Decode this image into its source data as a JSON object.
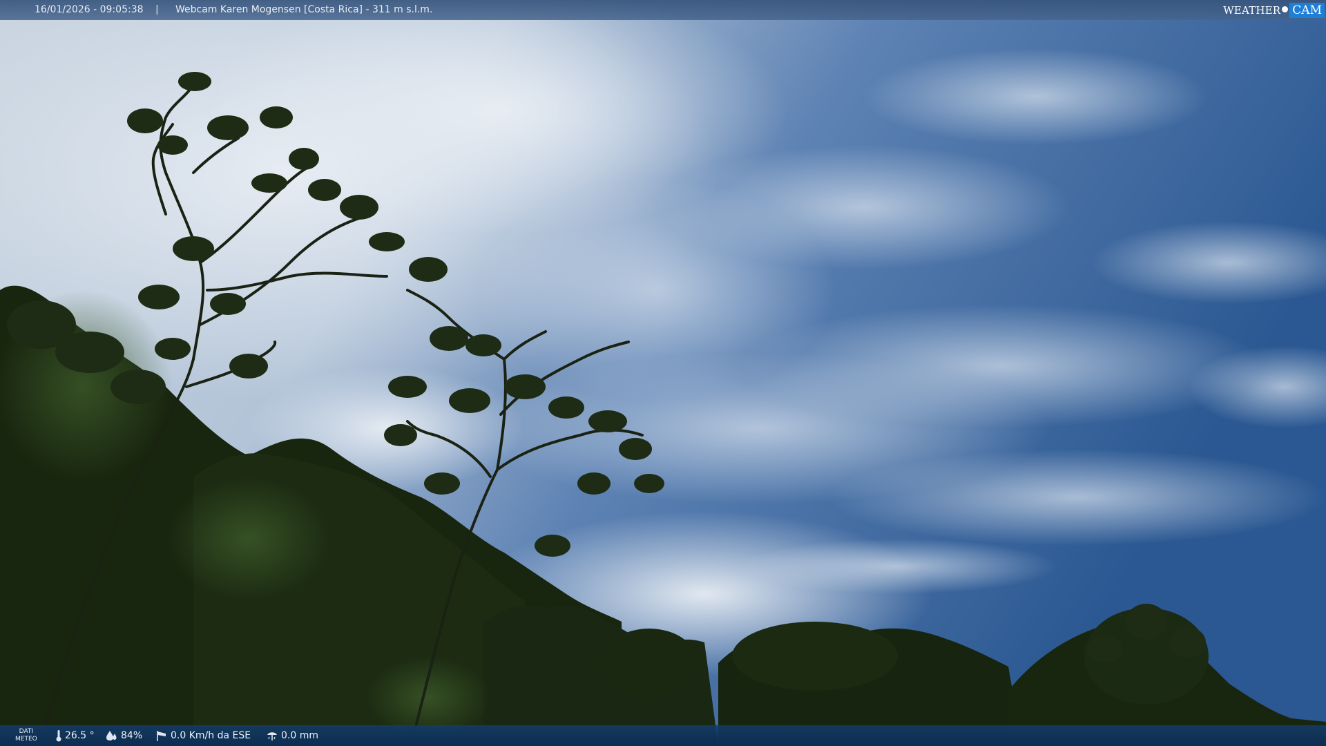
{
  "topbar": {
    "datetime": "16/01/2026 - 09:05:38",
    "separator": "|",
    "title": "Webcam Karen Mogensen [Costa Rica] - 311 m s.l.m."
  },
  "brand": {
    "part1": "WEATHER",
    "part2": "CAM"
  },
  "bottombar": {
    "label_line1": "DATI",
    "label_line2": "METEO",
    "temperature": "26.5 °",
    "humidity": "84%",
    "wind": "0.0 Km/h da ESE",
    "rain": "0.0 mm"
  },
  "icons": {
    "temperature": "thermometer-icon",
    "humidity": "water-drop-icon",
    "wind": "wind-sock-icon",
    "rain": "rain-gauge-icon"
  },
  "colors": {
    "sky_top_right": "#2a5690",
    "sky_clouds": "#c9d6e4",
    "foliage_dark": "#14210f",
    "bar_bottom": "#0f3a6b",
    "brand_accent": "#1f7fd6"
  }
}
